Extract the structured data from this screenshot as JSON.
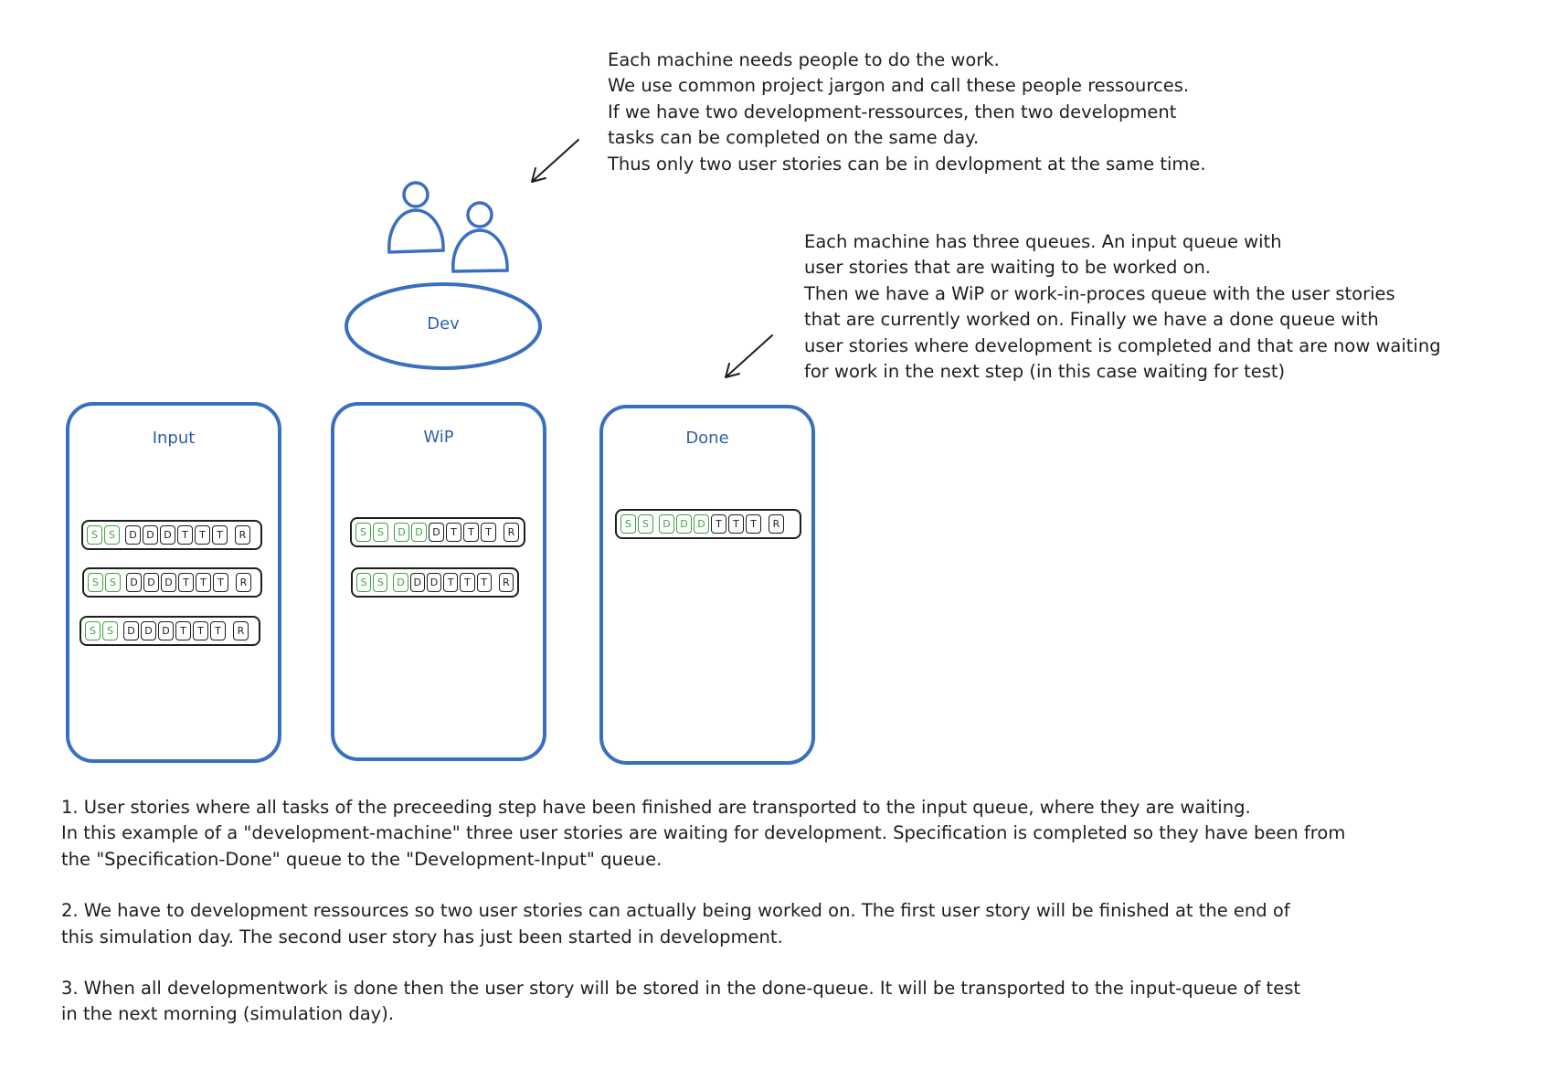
{
  "note_resources": [
    "Each machine needs people to do the work.",
    "We use common project jargon and call these people ressources.",
    "If we have two development-ressources, then two development",
    "tasks can be completed on the same day.",
    "Thus only two user stories can be in devlopment at the same time."
  ],
  "note_queues": [
    "Each machine has three queues. An input queue with",
    "user stories that are waiting to be worked on.",
    "Then we have a WiP or work-in-proces queue with the user stories",
    "that are currently worked on. Finally we have a done queue with",
    "user stories where development is completed and that are now waiting",
    "for work in the next step (in this case waiting for test)"
  ],
  "machine_label": "Dev",
  "queues": {
    "input": {
      "label": "Input",
      "stories": [
        {
          "tasks": [
            "S",
            "S",
            "D",
            "D",
            "D",
            "T",
            "T",
            "T",
            "R"
          ],
          "completed": 2
        },
        {
          "tasks": [
            "S",
            "S",
            "D",
            "D",
            "D",
            "T",
            "T",
            "T",
            "R"
          ],
          "completed": 2
        },
        {
          "tasks": [
            "S",
            "S",
            "D",
            "D",
            "D",
            "T",
            "T",
            "T",
            "R"
          ],
          "completed": 2
        }
      ]
    },
    "wip": {
      "label": "WiP",
      "stories": [
        {
          "tasks": [
            "S",
            "S",
            "D",
            "D",
            "D",
            "T",
            "T",
            "T",
            "R"
          ],
          "completed": 4
        },
        {
          "tasks": [
            "S",
            "S",
            "D",
            "D",
            "D",
            "T",
            "T",
            "T",
            "R"
          ],
          "completed": 3
        }
      ]
    },
    "done": {
      "label": "Done",
      "stories": [
        {
          "tasks": [
            "S",
            "S",
            "D",
            "D",
            "D",
            "T",
            "T",
            "T",
            "R"
          ],
          "completed": 5
        }
      ]
    }
  },
  "colors": {
    "machine": "#3a6fc0",
    "completed_task": "#3fa33f",
    "open_task": "#1e1e1e"
  },
  "explanation": [
    [
      "1. User stories where all tasks of the preceeding step have been finished are transported to the input queue, where they are waiting.",
      "In this example of a \"development-machine\" three user stories are waiting for development. Specification is completed so they have been from",
      "the \"Specification-Done\" queue to the \"Development-Input\" queue."
    ],
    [
      "2. We have to development ressources so two user stories can actually being worked on. The first user story will be finished at the end of",
      "this simulation day. The second user story has just been started in development."
    ],
    [
      "3. When all developmentwork is done then the user story will be stored in the done-queue. It will be transported to the input-queue of test",
      "in the next morning (simulation day)."
    ]
  ]
}
